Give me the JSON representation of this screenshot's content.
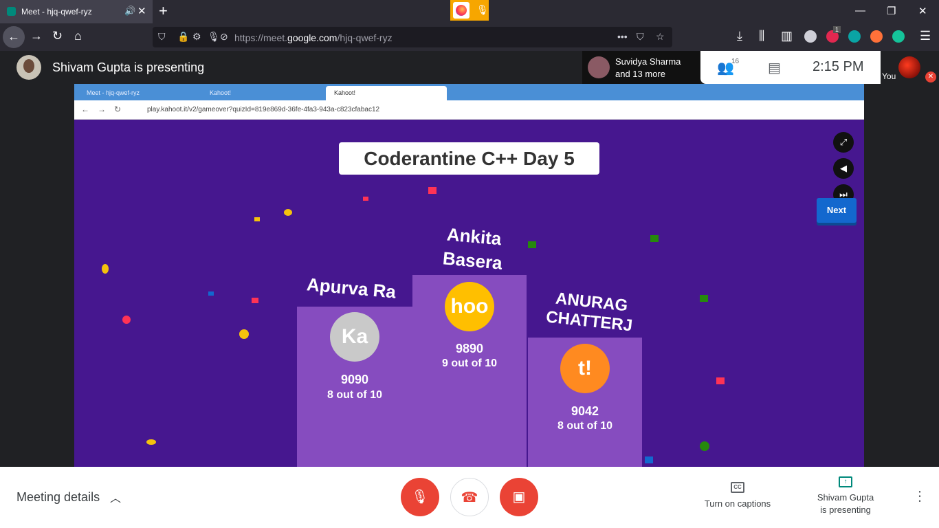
{
  "browser": {
    "tab_title": "Meet - hjq-qwef-ryz",
    "new_tab": "+",
    "url_prefix": "https://meet.",
    "url_domain": "google.com",
    "url_path": "/hjq-qwef-ryz",
    "badge_count": "1"
  },
  "meet_header": {
    "presenting_text": "Shivam Gupta is presenting",
    "participant_name": "Suvidya Sharma",
    "participant_more": "and 13 more",
    "people_count": "16",
    "time": "2:15  PM",
    "you_label": "You"
  },
  "shared_screen": {
    "tabs": [
      "Meet - hjq-qwef-ryz",
      "Kahoot!",
      "Kahoot!"
    ],
    "url": "play.kahoot.it/v2/gameover?quizId=819e869d-36fe-4fa3-943a-c823cfabac12",
    "game_title": "Coderantine C++ Day 5",
    "next_label": "Next",
    "podium": [
      {
        "rank": 2,
        "name": "Apurva Ra",
        "medal_text": "Ka",
        "score": "9090",
        "detail": "8 out of 10"
      },
      {
        "rank": 1,
        "name": "Ankita Basera",
        "medal_text": "hoo",
        "score": "9890",
        "detail": "9 out of 10"
      },
      {
        "rank": 3,
        "name": "ANURAG CHATTERJ",
        "medal_text": "t!",
        "score": "9042",
        "detail": "8 out of 10"
      }
    ],
    "name_lines": {
      "first_a": "Ankita",
      "first_b": "Basera",
      "third_a": "ANURAG",
      "third_b": "CHATTERJ"
    }
  },
  "bottom_bar": {
    "meeting_details": "Meeting details",
    "captions_label": "Turn on captions",
    "presenting_line1": "Shivam Gupta",
    "presenting_line2": "is presenting"
  },
  "colors": {
    "kahoot_purple": "#46178f",
    "podium": "#864cbf",
    "meet_red": "#ea4335",
    "next_blue": "#1368ce"
  }
}
